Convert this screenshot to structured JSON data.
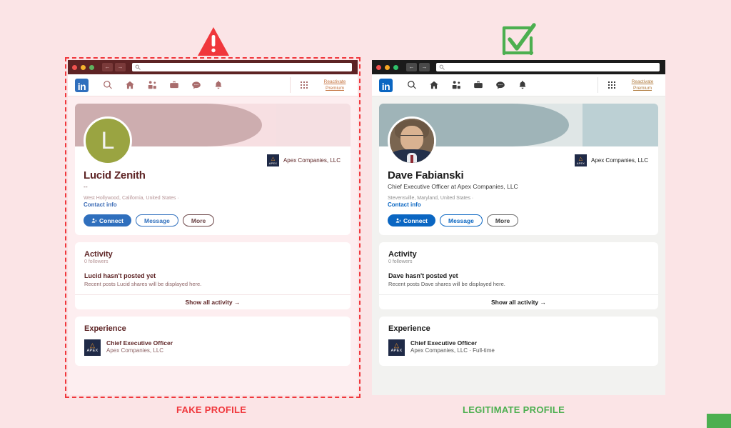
{
  "meta": {
    "page_background": "#fbe4e6",
    "fake_accent": "#f0373c",
    "legit_accent": "#4caf50"
  },
  "markers": {
    "fake_icon": "warning-triangle-icon",
    "legit_icon": "checkbox-checked-icon"
  },
  "labels": {
    "fake": "FAKE PROFILE",
    "legit": "LEGITIMATE PROFILE"
  },
  "browser_chrome": {
    "traffic_lights": [
      "close-red",
      "minimize-yellow",
      "maximize-green"
    ],
    "back_glyph": "←",
    "forward_glyph": "→",
    "url_value": "",
    "url_placeholder": "",
    "url_icon": "search-icon"
  },
  "linkedin_nav": {
    "logo_text": "in",
    "icons": [
      {
        "name": "search-icon",
        "label": "Search"
      },
      {
        "name": "home-icon",
        "label": "Home"
      },
      {
        "name": "my-network-icon",
        "label": "My Network"
      },
      {
        "name": "jobs-briefcase-icon",
        "label": "Jobs"
      },
      {
        "name": "messaging-icon",
        "label": "Messaging"
      },
      {
        "name": "notifications-bell-icon",
        "label": "Notifications"
      }
    ],
    "work_grid_icon": "work-grid-icon",
    "premium_line1": "Reactivate",
    "premium_line2": "Premium"
  },
  "fake_profile": {
    "window_theme": "maroon",
    "avatar": {
      "type": "letter",
      "letter": "L",
      "color": "#9aa441"
    },
    "name": "Lucid Zenith",
    "headline": "--",
    "location": "West Hollywood, California, United States ·",
    "contact_info": "Contact info",
    "buttons": {
      "connect": "Connect",
      "message": "Message",
      "more": "More"
    },
    "company_badge": {
      "logo_mark": "apex-logo-icon",
      "logo_word": "APEX",
      "name": "Apex Companies, LLC"
    },
    "activity": {
      "title": "Activity",
      "followers": "0 followers",
      "empty_heading": "Lucid hasn't posted yet",
      "empty_desc": "Recent posts Lucid shares will be displayed here.",
      "show_all": "Show all activity →"
    },
    "experience": {
      "title": "Experience",
      "items": [
        {
          "logo_word": "APEX",
          "role": "Chief Executive Officer",
          "company": "Apex Companies, LLC"
        }
      ]
    }
  },
  "legit_profile": {
    "window_theme": "dark",
    "avatar": {
      "type": "photo",
      "alt": "headshot-photo"
    },
    "name": "Dave Fabianski",
    "headline": "Chief Executive Officer at Apex Companies, LLC",
    "location": "Stevensville, Maryland, United States ·",
    "contact_info": "Contact info",
    "buttons": {
      "connect": "Connect",
      "message": "Message",
      "more": "More"
    },
    "company_badge": {
      "logo_mark": "apex-logo-icon",
      "logo_word": "APEX",
      "name": "Apex Companies, LLC"
    },
    "activity": {
      "title": "Activity",
      "followers": "0 followers",
      "empty_heading": "Dave hasn't posted yet",
      "empty_desc": "Recent posts Dave shares will be displayed here.",
      "show_all": "Show all activity →"
    },
    "experience": {
      "title": "Experience",
      "items": [
        {
          "logo_word": "APEX",
          "role": "Chief Executive Officer",
          "company": "Apex Companies, LLC · Full-time"
        }
      ]
    }
  }
}
